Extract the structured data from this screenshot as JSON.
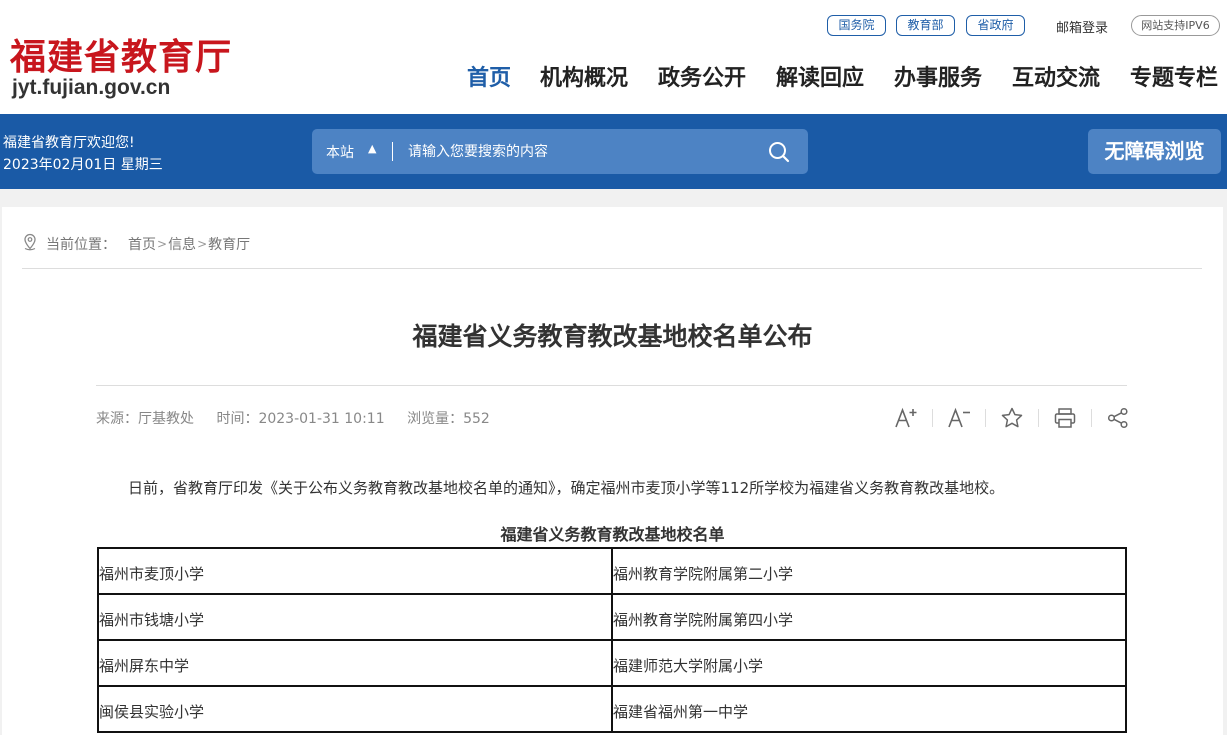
{
  "header": {
    "logo_cn": "福建省教育厅",
    "logo_en": "jyt.fujian.gov.cn",
    "quick_links": [
      "国务院",
      "教育部",
      "省政府"
    ],
    "mail_login": "邮箱登录",
    "ipv6": "网站支持IPV6",
    "nav": [
      "首页",
      "机构概况",
      "政务公开",
      "解读回应",
      "办事服务",
      "互动交流",
      "专题专栏"
    ]
  },
  "band": {
    "welcome": "福建省教育厅欢迎您!",
    "date": "2023年02月01日 星期三",
    "search_scope": "本站",
    "search_placeholder": "请输入您要搜索的内容",
    "accessibility": "无障碍浏览"
  },
  "breadcrumb": {
    "label": "当前位置：",
    "items": [
      "首页",
      "信息",
      "教育厅"
    ]
  },
  "article": {
    "title": "福建省义务教育教改基地校名单公布",
    "source": "来源：厅基教处",
    "time": "时间：2023-01-31 10:11",
    "views": "浏览量：552",
    "paragraph": "日前，省教育厅印发《关于公布义务教育教改基地校名单的通知》，确定福州市麦顶小学等112所学校为福建省义务教育教改基地校。",
    "table_caption": "福建省义务教育教改基地校名单",
    "rows": [
      [
        "福州市麦顶小学",
        "福州教育学院附属第二小学"
      ],
      [
        "福州市钱塘小学",
        "福州教育学院附属第四小学"
      ],
      [
        "福州屏东中学",
        "福建师范大学附属小学"
      ],
      [
        "闽侯县实验小学",
        "福建省福州第一中学"
      ]
    ]
  },
  "colors": {
    "brand_red": "#c8161d",
    "brand_blue": "#1a5aa6",
    "search_blue": "#4d83c4"
  },
  "icons": [
    "location-pin-icon",
    "search-icon",
    "font-increase-icon",
    "font-decrease-icon",
    "star-icon",
    "print-icon",
    "share-icon"
  ]
}
